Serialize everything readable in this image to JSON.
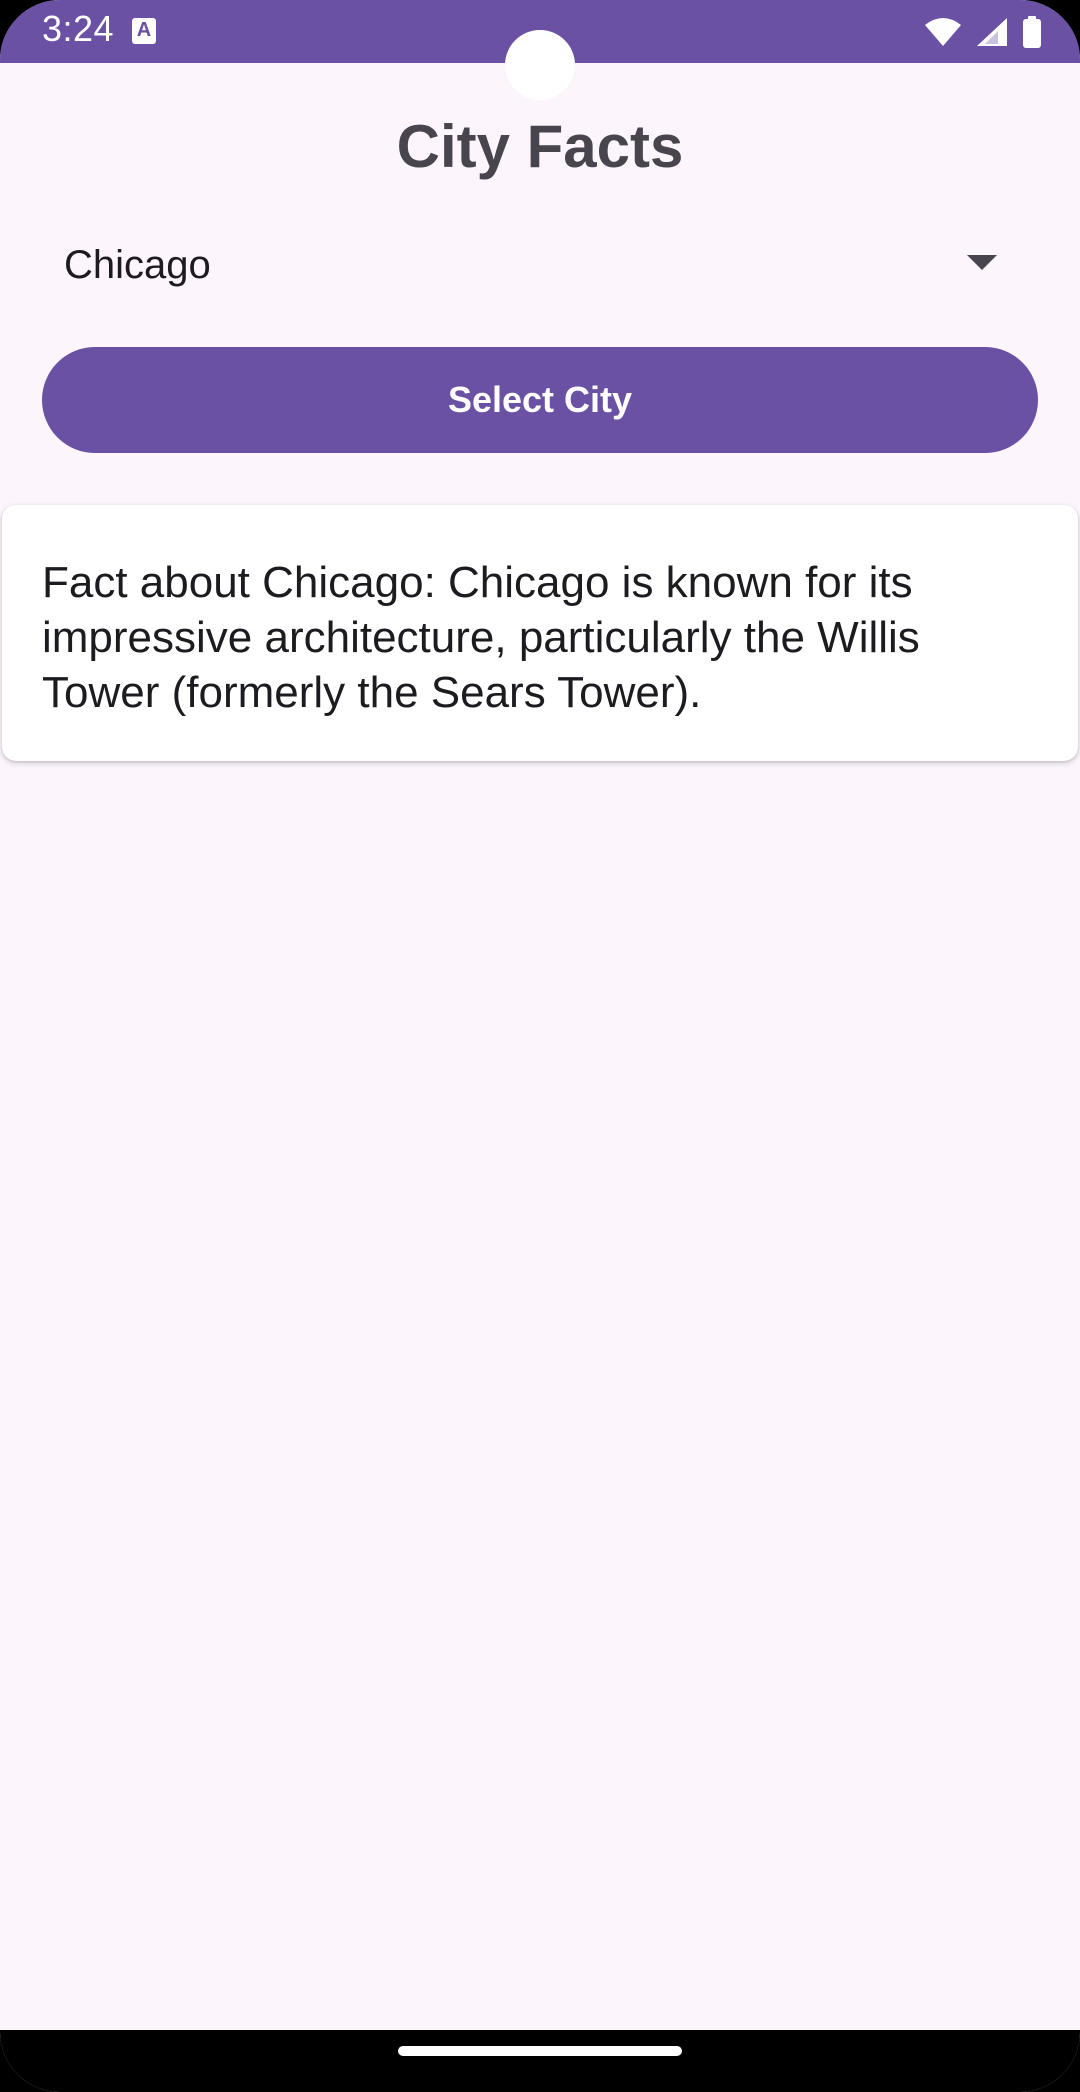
{
  "status_bar": {
    "time": "3:24",
    "notification_icon": "A",
    "icons": [
      "wifi-icon",
      "signal-icon",
      "battery-icon"
    ]
  },
  "header": {
    "title": "City Facts"
  },
  "dropdown": {
    "selected": "Chicago",
    "icon": "dropdown-arrow-icon"
  },
  "button": {
    "label": "Select City"
  },
  "fact": {
    "text": "Fact about Chicago: Chicago is known for its impressive architecture, particularly the Willis Tower (formerly the Sears Tower)."
  },
  "colors": {
    "primary": "#6A51A3",
    "background": "#FCF5FC",
    "title": "#48454E",
    "card": "#FFFFFF"
  }
}
